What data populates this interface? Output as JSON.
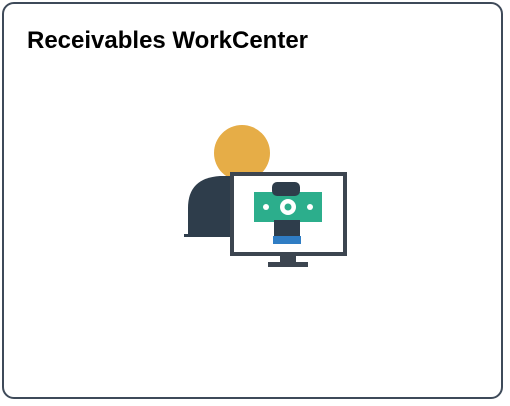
{
  "tile": {
    "title": "Receivables WorkCenter",
    "icon": "user-with-monitor-money-icon"
  },
  "colors": {
    "border": "#3e4a59",
    "head": "#e6ad47",
    "body": "#2e3d4b",
    "monitor_frame": "#3c4550",
    "bill": "#2cae8c",
    "sleeve": "#2f7dc4"
  }
}
